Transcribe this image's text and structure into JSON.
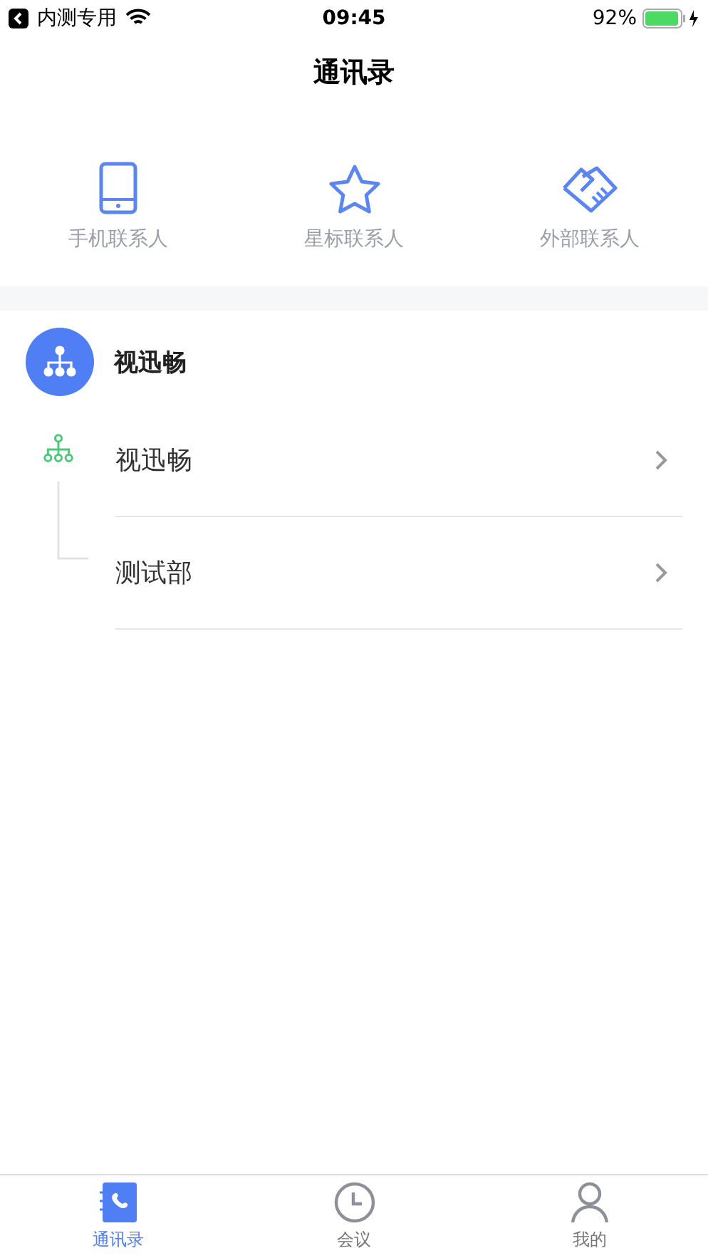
{
  "status_bar": {
    "back_label": "内测专用",
    "time": "09:45",
    "battery": "92%"
  },
  "title": "通讯录",
  "shortcuts": [
    {
      "kind": "phone",
      "label": "手机联系人"
    },
    {
      "kind": "star",
      "label": "星标联系人"
    },
    {
      "kind": "handshake",
      "label": "外部联系人"
    }
  ],
  "organization": {
    "name": "视迅畅",
    "departments": [
      {
        "name": "视迅畅",
        "kind": "root"
      },
      {
        "name": "测试部",
        "kind": "child"
      }
    ]
  },
  "tab_bar": [
    {
      "kind": "contacts",
      "label": "通讯录",
      "selected": true
    },
    {
      "kind": "clock",
      "label": "会议",
      "selected": false
    },
    {
      "kind": "person",
      "label": "我的",
      "selected": false
    }
  ]
}
